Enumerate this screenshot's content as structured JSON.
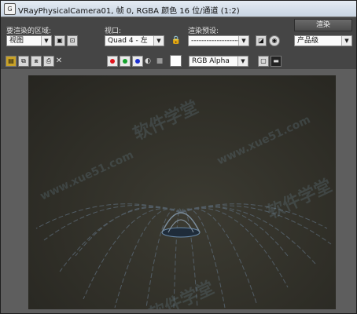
{
  "window": {
    "title": "VRayPhysicalCamera01, 帧 0, RGBA 颜色 16 位/通道 (1:2)"
  },
  "toolbar": {
    "area_label": "要渲染的区域:",
    "area_value": "视图",
    "viewport_label": "视口:",
    "viewport_value": "Quad 4 - 左",
    "preset_label": "渲染预设:",
    "preset_value": "---------------------",
    "render_button": "渲染",
    "quality_value": "产品级",
    "channel_value": "RGB Alpha"
  },
  "watermarks": [
    "软件学堂",
    "www.xue51.com",
    "软件学堂",
    "www.xue51.com",
    "软件学堂"
  ],
  "colors": {
    "red_channel": "#e0141c",
    "green_channel": "#15a22c",
    "blue_channel": "#1a2fd0",
    "swatch": "#ffffff"
  }
}
